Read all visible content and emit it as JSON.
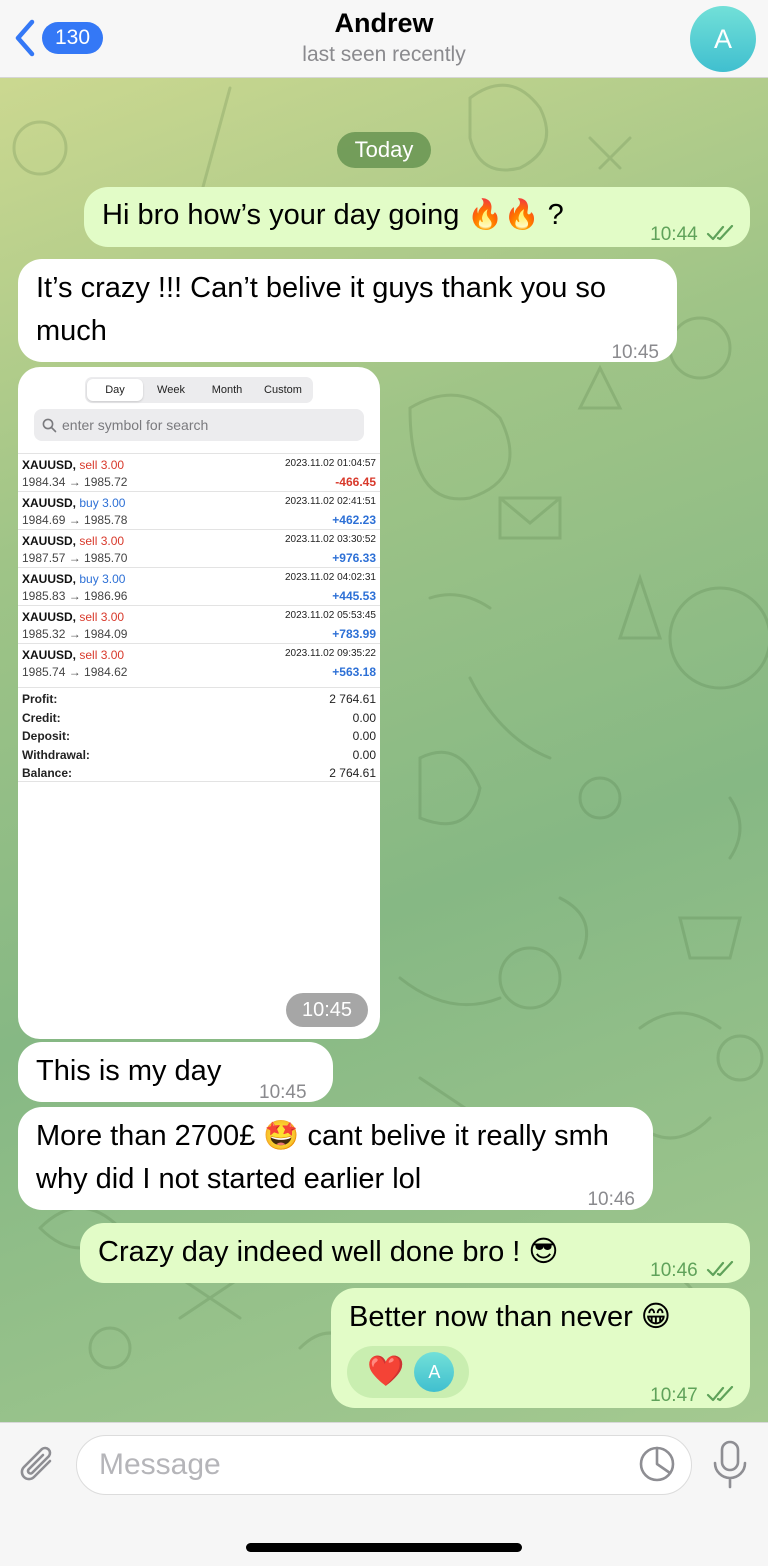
{
  "header": {
    "back_count": "130",
    "title": "Andrew",
    "subtitle": "last seen recently",
    "avatar_letter": "A"
  },
  "chat": {
    "date_label": "Today",
    "messages": [
      {
        "text": "Hi bro how’s your day going 🔥🔥 ?",
        "time": "10:44"
      },
      {
        "text": "It’s crazy !!! Can’t belive it guys thank you so much",
        "time": "10:45"
      },
      {
        "time": "10:45"
      },
      {
        "text": "This is my day",
        "time": "10:45"
      },
      {
        "text": "More than 2700£ 🤩 cant belive it really smh why did I not started earlier lol",
        "time": "10:46"
      },
      {
        "text": "Crazy day indeed well done bro ! 😎",
        "time": "10:46"
      },
      {
        "text": "Better now than never 😁",
        "time": "10:47",
        "reaction": "❤️",
        "reaction_avatar": "A"
      }
    ]
  },
  "screenshot": {
    "tabs": [
      "Day",
      "Week",
      "Month",
      "Custom"
    ],
    "active_tab": "Day",
    "search_placeholder": "enter symbol for search",
    "deals": [
      {
        "symbol": "XAUUSD,",
        "side": "sell",
        "volume": "3.00",
        "prices": "1984.34 → 1985.72",
        "date": "2023.11.02 01:04:57",
        "profit": "-466.45"
      },
      {
        "symbol": "XAUUSD,",
        "side": "buy",
        "volume": "3.00",
        "prices": "1984.69 → 1985.78",
        "date": "2023.11.02 02:41:51",
        "profit": "+462.23"
      },
      {
        "symbol": "XAUUSD,",
        "side": "sell",
        "volume": "3.00",
        "prices": "1987.57 → 1985.70",
        "date": "2023.11.02 03:30:52",
        "profit": "+976.33"
      },
      {
        "symbol": "XAUUSD,",
        "side": "buy",
        "volume": "3.00",
        "prices": "1985.83 → 1986.96",
        "date": "2023.11.02 04:02:31",
        "profit": "+445.53"
      },
      {
        "symbol": "XAUUSD,",
        "side": "sell",
        "volume": "3.00",
        "prices": "1985.32 → 1984.09",
        "date": "2023.11.02 05:53:45",
        "profit": "+783.99"
      },
      {
        "symbol": "XAUUSD,",
        "side": "sell",
        "volume": "3.00",
        "prices": "1985.74 → 1984.62",
        "date": "2023.11.02 09:35:22",
        "profit": "+563.18"
      }
    ],
    "summary": [
      {
        "label": "Profit:",
        "value": "2 764.61"
      },
      {
        "label": "Credit:",
        "value": "0.00"
      },
      {
        "label": "Deposit:",
        "value": "0.00"
      },
      {
        "label": "Withdrawal:",
        "value": "0.00"
      },
      {
        "label": "Balance:",
        "value": "2 764.61"
      }
    ]
  },
  "composer": {
    "placeholder": "Message"
  },
  "colors": {
    "accent": "#3478f6",
    "outgoing_bubble": "#e2fcc7",
    "incoming_bubble": "#ffffff",
    "sell": "#d8392b",
    "buy": "#2d70d6"
  }
}
